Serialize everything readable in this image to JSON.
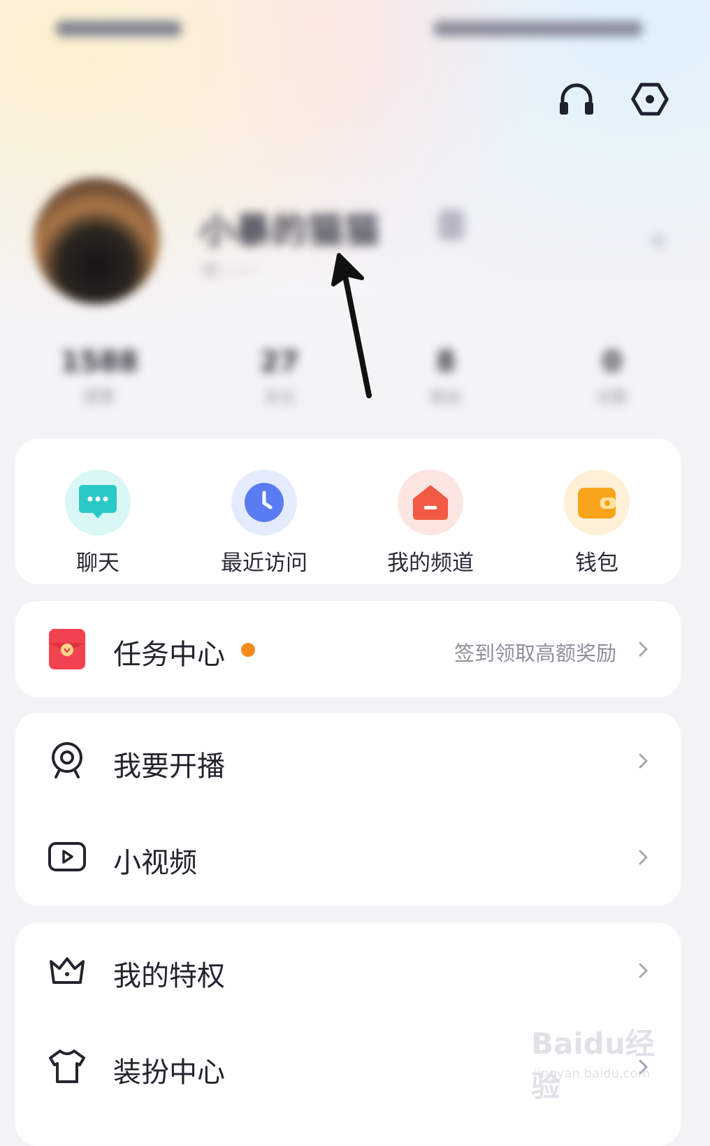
{
  "header": {
    "headset_icon": "headset-icon",
    "settings_icon": "hexagon-settings-icon"
  },
  "profile": {
    "username": "小暴的猫猫",
    "subline": "ID ·······"
  },
  "stats": [
    {
      "value": "1588",
      "label": "获赞"
    },
    {
      "value": "27",
      "label": "关注"
    },
    {
      "value": "8",
      "label": "粉丝"
    },
    {
      "value": "0",
      "label": "访客"
    }
  ],
  "quick_actions": [
    {
      "label": "聊天",
      "icon": "chat-bubble-icon",
      "color": "#2ac9c8"
    },
    {
      "label": "最近访问",
      "icon": "clock-icon",
      "color": "#5a7cf2"
    },
    {
      "label": "我的频道",
      "icon": "house-icon",
      "color": "#f25a45"
    },
    {
      "label": "钱包",
      "icon": "wallet-icon",
      "color": "#f9a31b"
    }
  ],
  "task_center": {
    "label": "任务中心",
    "hint": "签到领取高额奖励",
    "accent": "#f48a1b"
  },
  "menu_group_1": [
    {
      "label": "我要开播",
      "icon": "live-camera-icon"
    },
    {
      "label": "小视频",
      "icon": "video-play-icon"
    }
  ],
  "menu_group_2": [
    {
      "label": "我的特权",
      "icon": "crown-icon"
    },
    {
      "label": "装扮中心",
      "icon": "tshirt-icon"
    }
  ],
  "watermark": {
    "logo": "Baidu经验",
    "site": "jingyan.baidu.com"
  }
}
